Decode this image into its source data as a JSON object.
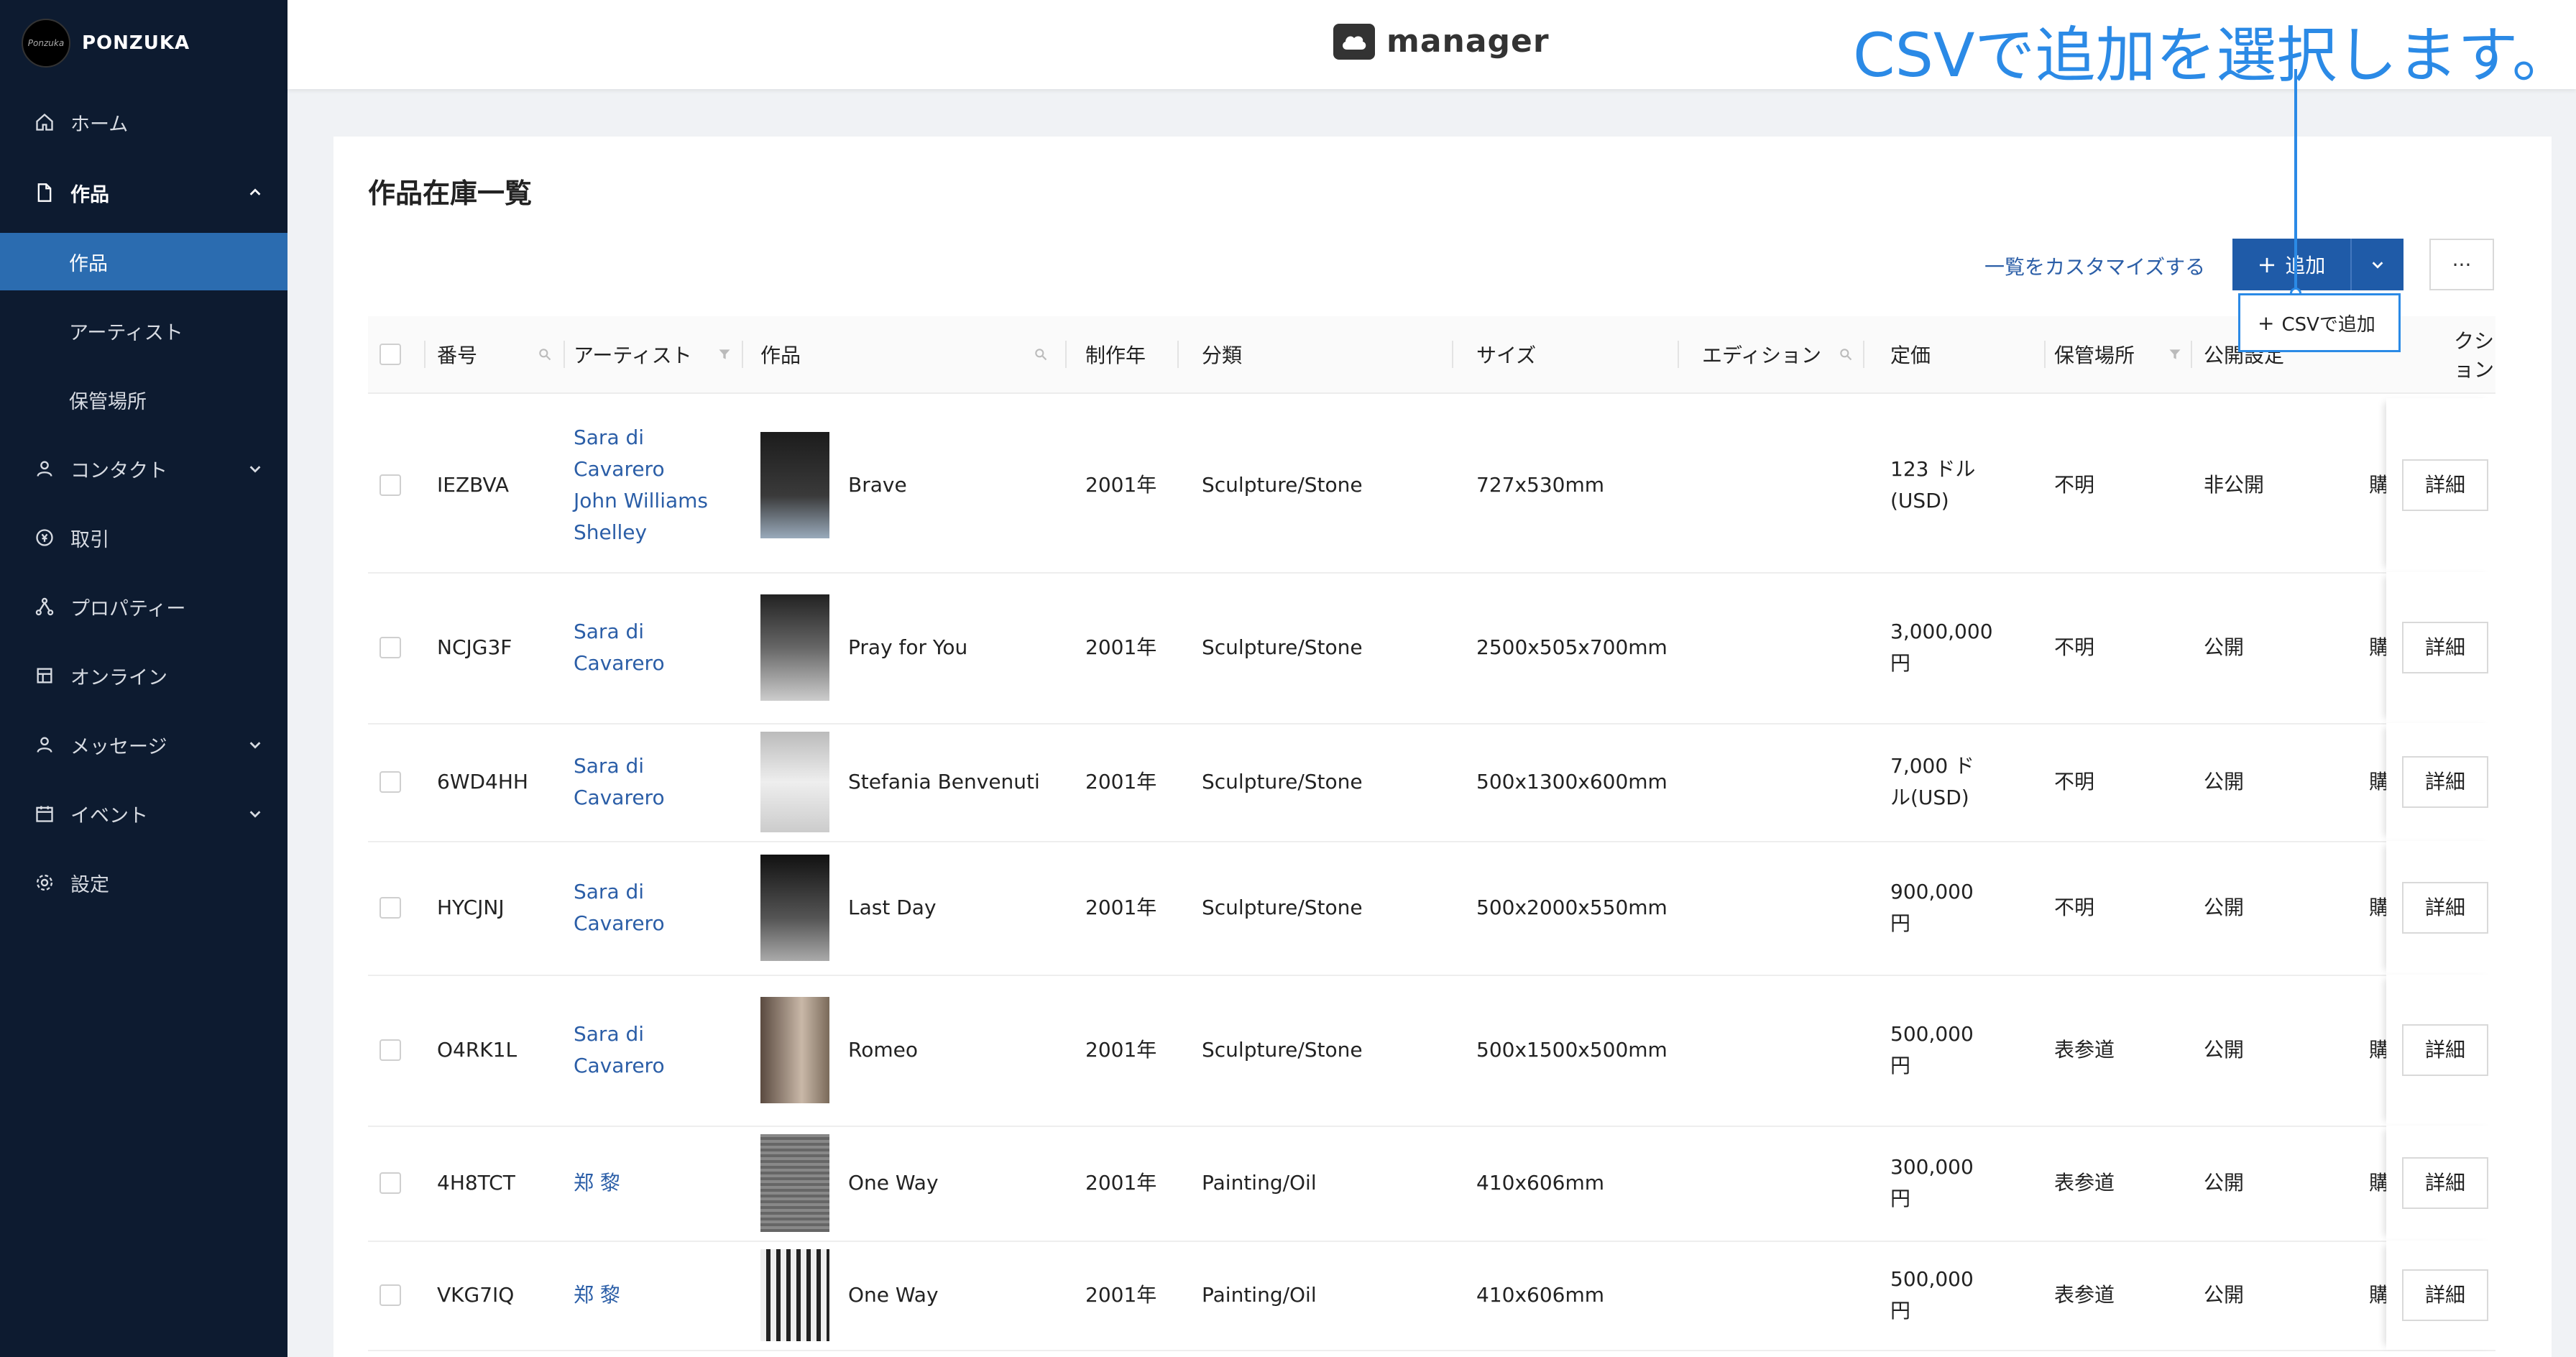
{
  "sidebar": {
    "brand": "PONZUKA",
    "logo_text": "Ponzuka",
    "items": [
      {
        "label": "ホーム",
        "icon": "home-icon"
      },
      {
        "label": "作品",
        "icon": "file-icon"
      },
      {
        "label": "作品",
        "icon": ""
      },
      {
        "label": "アーティスト",
        "icon": ""
      },
      {
        "label": "保管場所",
        "icon": ""
      },
      {
        "label": "コンタクト",
        "icon": "user-icon"
      },
      {
        "label": "取引",
        "icon": "currency-icon"
      },
      {
        "label": "プロパティー",
        "icon": "network-icon"
      },
      {
        "label": "オンライン",
        "icon": "shop-icon"
      },
      {
        "label": "メッセージ",
        "icon": "user-icon"
      },
      {
        "label": "イベント",
        "icon": "calendar-icon"
      },
      {
        "label": "設定",
        "icon": "gear-icon"
      }
    ]
  },
  "header": {
    "app_name": "manager"
  },
  "annotation": {
    "text": "CSVで追加を選択します。"
  },
  "page": {
    "title": "作品在庫一覧",
    "customize_link": "一覧をカスタマイズする",
    "add_button": "追加",
    "more_button": "···",
    "dropdown_item": "CSVで追加"
  },
  "table": {
    "headers": [
      "番号",
      "アーティスト",
      "作品",
      "制作年",
      "分類",
      "サイズ",
      "エディション",
      "定価",
      "保管場所",
      "公開設定",
      "アクション"
    ],
    "header_truncated_action": "クション",
    "detail_label": "詳細",
    "rows": [
      {
        "id": "IEZBVA",
        "artist": [
          "Sara di",
          "Cavarero",
          "John Williams",
          "Shelley"
        ],
        "title": "Brave",
        "year": "2001年",
        "category": "Sculpture/Stone",
        "size": "727x530mm",
        "edition": "",
        "price": [
          "123 ドル",
          "(USD)"
        ],
        "location": "不明",
        "visibility": "非公開",
        "trunc": "購"
      },
      {
        "id": "NCJG3F",
        "artist": [
          "Sara di",
          "Cavarero"
        ],
        "title": "Pray for You",
        "year": "2001年",
        "category": "Sculpture/Stone",
        "size": "2500x505x700mm",
        "edition": "",
        "price": [
          "3,000,000",
          "円"
        ],
        "location": "不明",
        "visibility": "公開",
        "trunc": "購"
      },
      {
        "id": "6WD4HH",
        "artist": [
          "Sara di",
          "Cavarero"
        ],
        "title": "Stefania Benvenuti",
        "year": "2001年",
        "category": "Sculpture/Stone",
        "size": "500x1300x600mm",
        "edition": "",
        "price": [
          "7,000 ド",
          "ル(USD)"
        ],
        "location": "不明",
        "visibility": "公開",
        "trunc": "購"
      },
      {
        "id": "HYCJNJ",
        "artist": [
          "Sara di",
          "Cavarero"
        ],
        "title": "Last Day",
        "year": "2001年",
        "category": "Sculpture/Stone",
        "size": "500x2000x550mm",
        "edition": "",
        "price": [
          "900,000",
          "円"
        ],
        "location": "不明",
        "visibility": "公開",
        "trunc": "購"
      },
      {
        "id": "O4RK1L",
        "artist": [
          "Sara di",
          "Cavarero"
        ],
        "title": "Romeo",
        "year": "2001年",
        "category": "Sculpture/Stone",
        "size": "500x1500x500mm",
        "edition": "",
        "price": [
          "500,000",
          "円"
        ],
        "location": "表参道",
        "visibility": "公開",
        "trunc": "購"
      },
      {
        "id": "4H8TCT",
        "artist": [
          "郑 黎"
        ],
        "title": "One Way",
        "year": "2001年",
        "category": "Painting/Oil",
        "size": "410x606mm",
        "edition": "",
        "price": [
          "300,000",
          "円"
        ],
        "location": "表参道",
        "visibility": "公開",
        "trunc": "購"
      },
      {
        "id": "VKG7IQ",
        "artist": [
          "郑 黎"
        ],
        "title": "One Way",
        "year": "2001年",
        "category": "Painting/Oil",
        "size": "410x606mm",
        "edition": "",
        "price": [
          "500,000",
          "円"
        ],
        "location": "表参道",
        "visibility": "公開",
        "trunc": "購"
      }
    ]
  },
  "colors": {
    "sidebar_bg": "#0d1b30",
    "active_item": "#2b6cb0",
    "primary_button": "#1f5ba8",
    "link": "#2b5ea7",
    "annotation": "#2b8ae6"
  }
}
